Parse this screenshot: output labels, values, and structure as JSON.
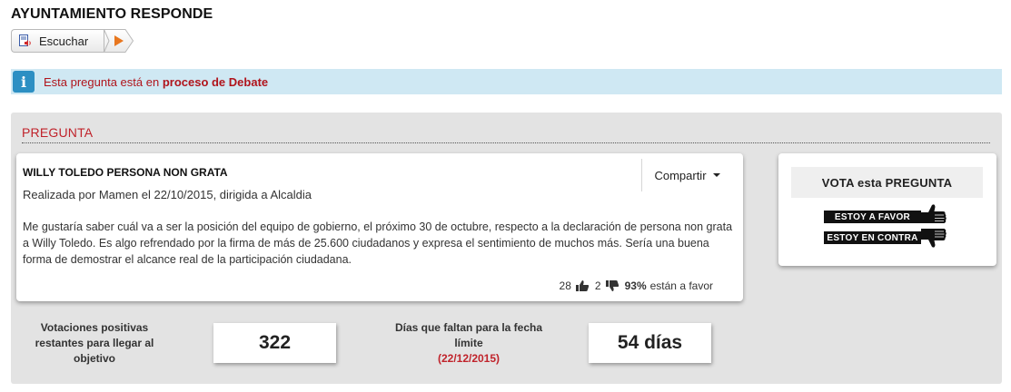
{
  "page": {
    "title": "AYUNTAMIENTO RESPONDE"
  },
  "listen": {
    "label": "Escuchar"
  },
  "alert": {
    "text_prefix": "Esta pregunta está en ",
    "text_status": "proceso de Debate"
  },
  "section": {
    "title": "PREGUNTA"
  },
  "question": {
    "title": "WILLY TOLEDO PERSONA NON GRATA",
    "meta": "Realizada por Mamen el 22/10/2015, dirigida a Alcaldia",
    "share_label": "Compartir",
    "body": "Me gustaría saber cuál va a ser la posición del equipo de gobierno, el próximo 30 de octubre, respecto a la declaración de persona non grata a Willy Toledo. Es algo refrendado por la firma de más de 25.600 ciudadanos y expresa el sentimiento de muchos más. Sería una buena forma de demostrar el alcance real de la participación ciudadana.",
    "stats": {
      "likes": "28",
      "dislikes": "2",
      "percent": "93%",
      "percent_label": "están a favor"
    }
  },
  "vote": {
    "title": "VOTA esta PREGUNTA",
    "favor_label": "ESTOY A FAVOR",
    "contra_label": "ESTOY EN CONTRA"
  },
  "counters": {
    "remaining_label": "Votaciones positivas restantes para llegar al objetivo",
    "remaining_value": "322",
    "days_label": "Días que faltan para la fecha límite",
    "days_date": "(22/12/2015)",
    "days_value": "54 días"
  },
  "colors": {
    "accent_red": "#c0232b",
    "info_bg": "#cfe8f3",
    "info_icon": "#2c8fc3",
    "panel_bg": "#e3e3e3"
  }
}
